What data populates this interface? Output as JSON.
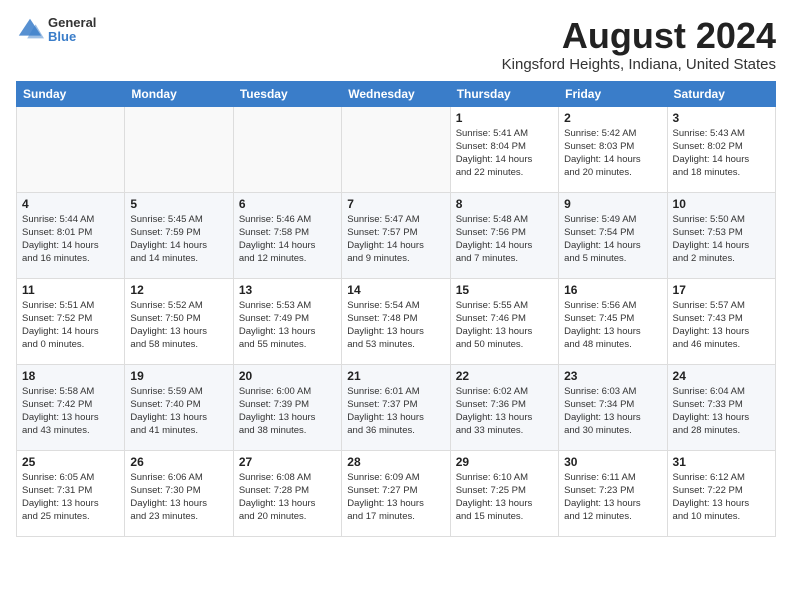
{
  "logo": {
    "general": "General",
    "blue": "Blue"
  },
  "title": "August 2024",
  "location": "Kingsford Heights, Indiana, United States",
  "headers": [
    "Sunday",
    "Monday",
    "Tuesday",
    "Wednesday",
    "Thursday",
    "Friday",
    "Saturday"
  ],
  "weeks": [
    [
      {
        "day": "",
        "info": ""
      },
      {
        "day": "",
        "info": ""
      },
      {
        "day": "",
        "info": ""
      },
      {
        "day": "",
        "info": ""
      },
      {
        "day": "1",
        "info": "Sunrise: 5:41 AM\nSunset: 8:04 PM\nDaylight: 14 hours\nand 22 minutes."
      },
      {
        "day": "2",
        "info": "Sunrise: 5:42 AM\nSunset: 8:03 PM\nDaylight: 14 hours\nand 20 minutes."
      },
      {
        "day": "3",
        "info": "Sunrise: 5:43 AM\nSunset: 8:02 PM\nDaylight: 14 hours\nand 18 minutes."
      }
    ],
    [
      {
        "day": "4",
        "info": "Sunrise: 5:44 AM\nSunset: 8:01 PM\nDaylight: 14 hours\nand 16 minutes."
      },
      {
        "day": "5",
        "info": "Sunrise: 5:45 AM\nSunset: 7:59 PM\nDaylight: 14 hours\nand 14 minutes."
      },
      {
        "day": "6",
        "info": "Sunrise: 5:46 AM\nSunset: 7:58 PM\nDaylight: 14 hours\nand 12 minutes."
      },
      {
        "day": "7",
        "info": "Sunrise: 5:47 AM\nSunset: 7:57 PM\nDaylight: 14 hours\nand 9 minutes."
      },
      {
        "day": "8",
        "info": "Sunrise: 5:48 AM\nSunset: 7:56 PM\nDaylight: 14 hours\nand 7 minutes."
      },
      {
        "day": "9",
        "info": "Sunrise: 5:49 AM\nSunset: 7:54 PM\nDaylight: 14 hours\nand 5 minutes."
      },
      {
        "day": "10",
        "info": "Sunrise: 5:50 AM\nSunset: 7:53 PM\nDaylight: 14 hours\nand 2 minutes."
      }
    ],
    [
      {
        "day": "11",
        "info": "Sunrise: 5:51 AM\nSunset: 7:52 PM\nDaylight: 14 hours\nand 0 minutes."
      },
      {
        "day": "12",
        "info": "Sunrise: 5:52 AM\nSunset: 7:50 PM\nDaylight: 13 hours\nand 58 minutes."
      },
      {
        "day": "13",
        "info": "Sunrise: 5:53 AM\nSunset: 7:49 PM\nDaylight: 13 hours\nand 55 minutes."
      },
      {
        "day": "14",
        "info": "Sunrise: 5:54 AM\nSunset: 7:48 PM\nDaylight: 13 hours\nand 53 minutes."
      },
      {
        "day": "15",
        "info": "Sunrise: 5:55 AM\nSunset: 7:46 PM\nDaylight: 13 hours\nand 50 minutes."
      },
      {
        "day": "16",
        "info": "Sunrise: 5:56 AM\nSunset: 7:45 PM\nDaylight: 13 hours\nand 48 minutes."
      },
      {
        "day": "17",
        "info": "Sunrise: 5:57 AM\nSunset: 7:43 PM\nDaylight: 13 hours\nand 46 minutes."
      }
    ],
    [
      {
        "day": "18",
        "info": "Sunrise: 5:58 AM\nSunset: 7:42 PM\nDaylight: 13 hours\nand 43 minutes."
      },
      {
        "day": "19",
        "info": "Sunrise: 5:59 AM\nSunset: 7:40 PM\nDaylight: 13 hours\nand 41 minutes."
      },
      {
        "day": "20",
        "info": "Sunrise: 6:00 AM\nSunset: 7:39 PM\nDaylight: 13 hours\nand 38 minutes."
      },
      {
        "day": "21",
        "info": "Sunrise: 6:01 AM\nSunset: 7:37 PM\nDaylight: 13 hours\nand 36 minutes."
      },
      {
        "day": "22",
        "info": "Sunrise: 6:02 AM\nSunset: 7:36 PM\nDaylight: 13 hours\nand 33 minutes."
      },
      {
        "day": "23",
        "info": "Sunrise: 6:03 AM\nSunset: 7:34 PM\nDaylight: 13 hours\nand 30 minutes."
      },
      {
        "day": "24",
        "info": "Sunrise: 6:04 AM\nSunset: 7:33 PM\nDaylight: 13 hours\nand 28 minutes."
      }
    ],
    [
      {
        "day": "25",
        "info": "Sunrise: 6:05 AM\nSunset: 7:31 PM\nDaylight: 13 hours\nand 25 minutes."
      },
      {
        "day": "26",
        "info": "Sunrise: 6:06 AM\nSunset: 7:30 PM\nDaylight: 13 hours\nand 23 minutes."
      },
      {
        "day": "27",
        "info": "Sunrise: 6:08 AM\nSunset: 7:28 PM\nDaylight: 13 hours\nand 20 minutes."
      },
      {
        "day": "28",
        "info": "Sunrise: 6:09 AM\nSunset: 7:27 PM\nDaylight: 13 hours\nand 17 minutes."
      },
      {
        "day": "29",
        "info": "Sunrise: 6:10 AM\nSunset: 7:25 PM\nDaylight: 13 hours\nand 15 minutes."
      },
      {
        "day": "30",
        "info": "Sunrise: 6:11 AM\nSunset: 7:23 PM\nDaylight: 13 hours\nand 12 minutes."
      },
      {
        "day": "31",
        "info": "Sunrise: 6:12 AM\nSunset: 7:22 PM\nDaylight: 13 hours\nand 10 minutes."
      }
    ]
  ]
}
